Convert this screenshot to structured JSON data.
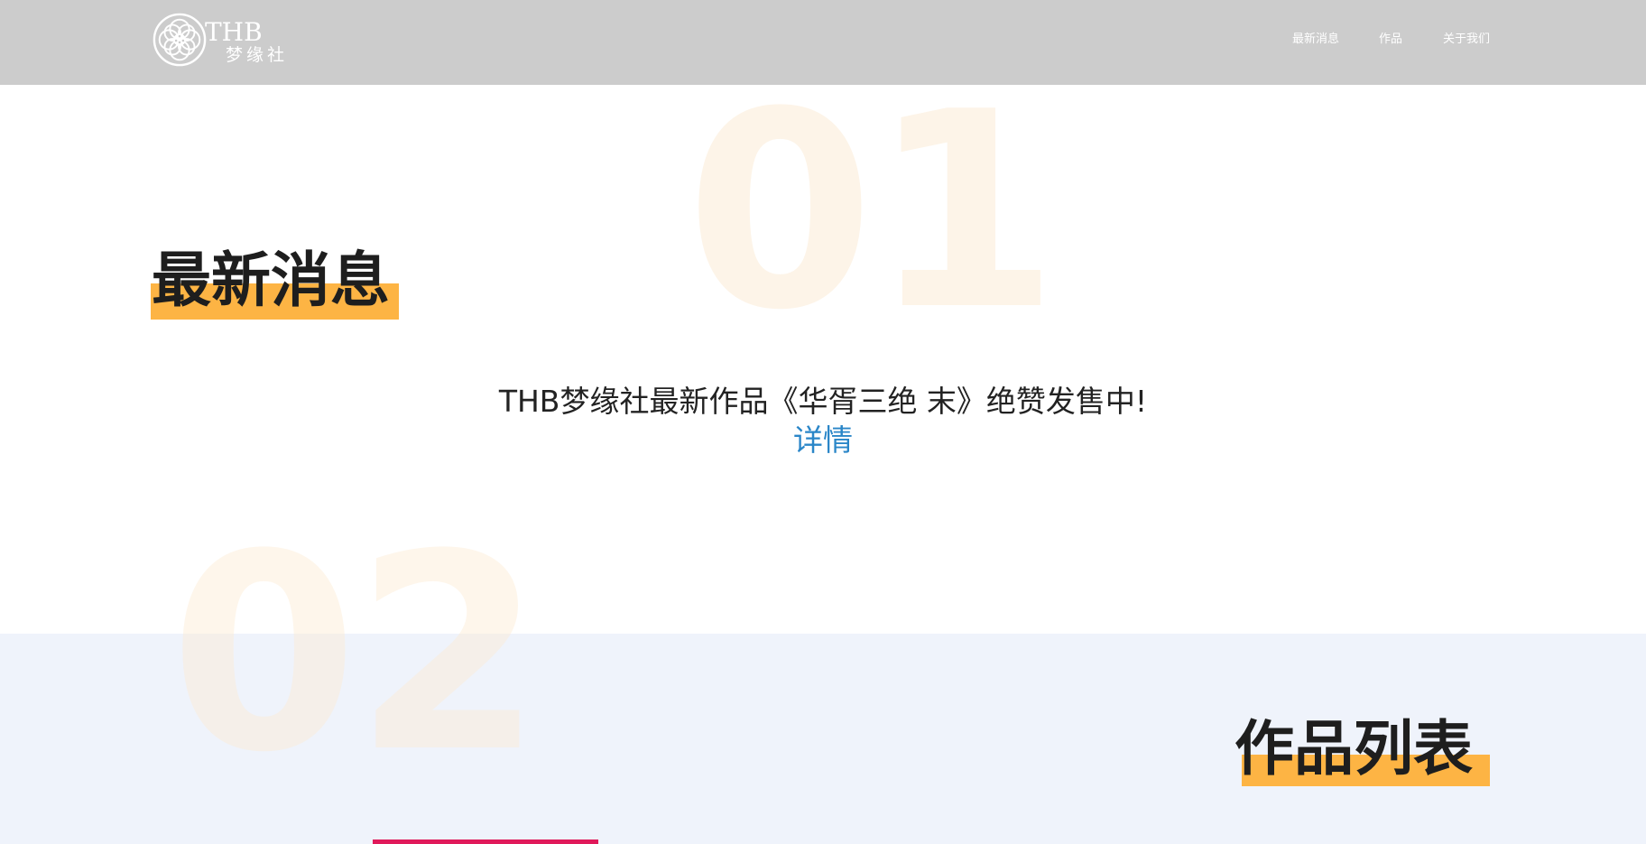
{
  "header": {
    "logo": {
      "text": "THB",
      "subtext": "梦缘社"
    },
    "nav": [
      {
        "label": "最新消息"
      },
      {
        "label": "作品"
      },
      {
        "label": "关于我们"
      }
    ]
  },
  "sections": {
    "news": {
      "number": "01",
      "title": "最新消息",
      "text": "THB梦缘社最新作品《华胥三绝 末》绝赞发售中!",
      "link": "详情"
    },
    "works": {
      "number": "02",
      "title": "作品列表"
    }
  },
  "colors": {
    "header_bg": "#cccccc",
    "accent": "#fdb444",
    "link": "#2a86c8",
    "section2_bg": "#eff3fb"
  }
}
